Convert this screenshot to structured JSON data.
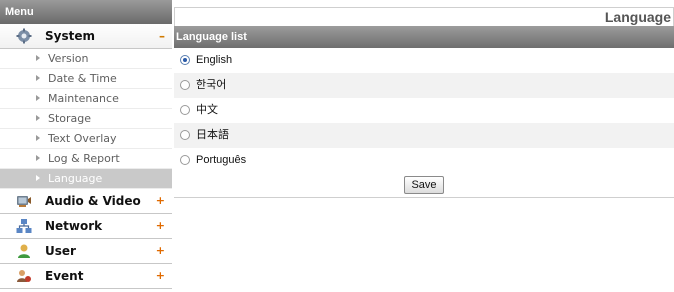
{
  "sidebar": {
    "title": "Menu",
    "sections": [
      {
        "label": "System",
        "toggle": "–",
        "icon": "system-icon",
        "open": true
      },
      {
        "label": "Audio & Video",
        "toggle": "+",
        "icon": "audio-video-icon"
      },
      {
        "label": "Network",
        "toggle": "+",
        "icon": "network-icon"
      },
      {
        "label": "User",
        "toggle": "+",
        "icon": "user-icon"
      },
      {
        "label": "Event",
        "toggle": "+",
        "icon": "event-icon"
      }
    ],
    "system_items": [
      {
        "label": "Version"
      },
      {
        "label": "Date & Time"
      },
      {
        "label": "Maintenance"
      },
      {
        "label": "Storage"
      },
      {
        "label": "Text Overlay"
      },
      {
        "label": "Log & Report"
      },
      {
        "label": "Language",
        "active": true
      }
    ]
  },
  "main": {
    "page_title": "Language",
    "panel_title": "Language list",
    "languages": [
      {
        "label": "English",
        "selected": true
      },
      {
        "label": "한국어"
      },
      {
        "label": "中文"
      },
      {
        "label": "日本語"
      },
      {
        "label": "Português"
      }
    ],
    "save_label": "Save"
  },
  "colors": {
    "header_gradient_top": "#9a9a9a",
    "header_gradient_bottom": "#6a6a6a",
    "active_item_bg": "#c9c9c9",
    "toggle_orange": "#e06a00"
  }
}
